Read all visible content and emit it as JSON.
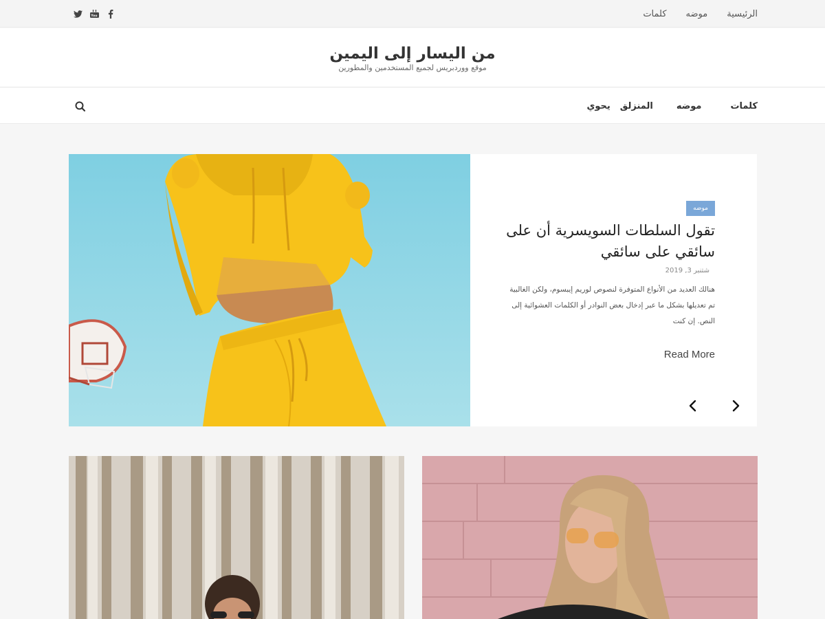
{
  "topbar": {
    "nav": [
      "الرئيسية",
      "موضه",
      "كلمات"
    ],
    "social": [
      {
        "name": "facebook-icon",
        "glyph": "f"
      },
      {
        "name": "youtube-icon",
        "glyph": "▶"
      },
      {
        "name": "twitter-icon",
        "glyph": "t"
      }
    ]
  },
  "header": {
    "title": "من اليسار إلى اليمين",
    "description": "موقع ووردبريس لجميع المستخدمين والمطورين"
  },
  "mainnav": {
    "items": [
      "كلمات",
      "موضه",
      "المنزلق",
      "يحوي"
    ],
    "search_icon": "search-icon"
  },
  "slider": {
    "badge": "موضه",
    "title": "تقول السلطات السويسرية أن على سائقي على سائقي",
    "date": "شتنبر 3, 2019",
    "excerpt": "هنالك العديد من الأنواع المتوفرة لنصوص لوريم إيبسوم، ولكن الغالبية تم تعديلها بشكل ما عبر إدخال بعض النوادر أو الكلمات العشوائية إلى النص. إن كنت",
    "read_more": "Read More",
    "prev_icon": "chevron-left-icon",
    "next_icon": "chevron-right-icon"
  },
  "colors": {
    "accent": "#7aa7d8",
    "background": "#f6f6f6",
    "yellow": "#f7c21a",
    "sky": "#8fd3e3",
    "pink": "#d9a7ab"
  }
}
